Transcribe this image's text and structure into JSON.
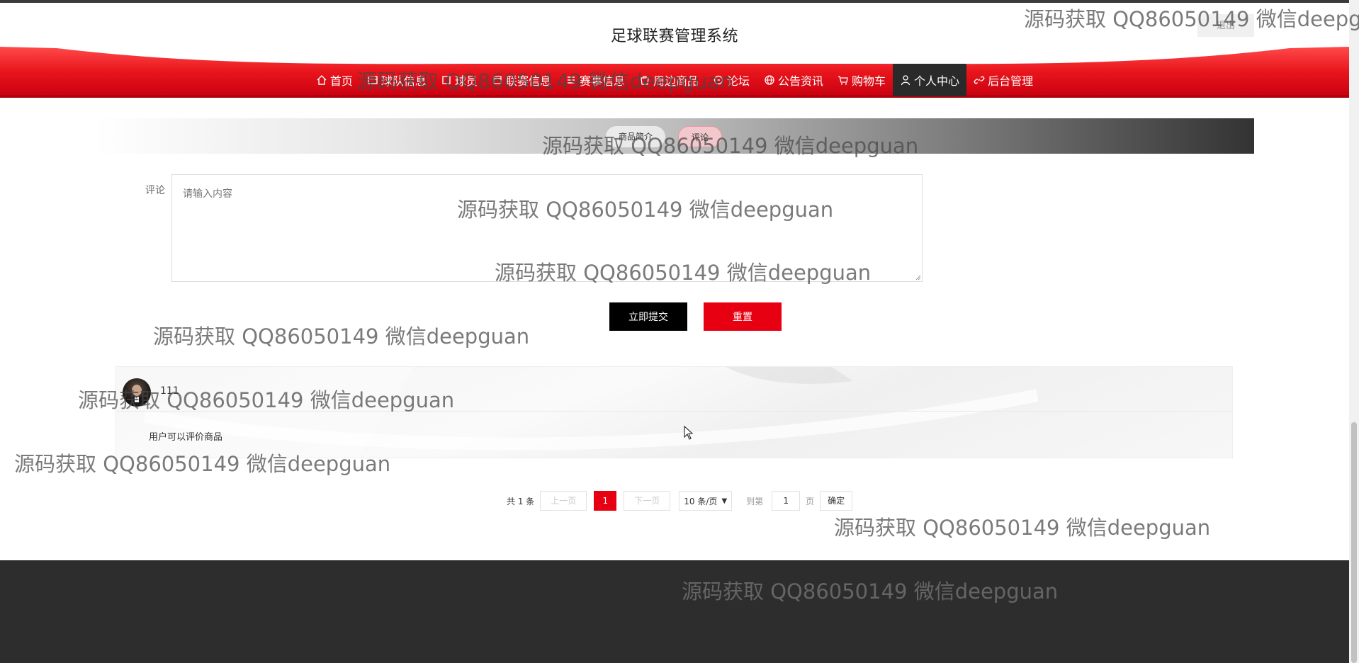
{
  "header": {
    "site_title": "足球联赛管理系统",
    "logout_label": "退出"
  },
  "nav": {
    "items": [
      {
        "label": "首页",
        "icon": "home-icon"
      },
      {
        "label": "球队信息",
        "icon": "team-icon"
      },
      {
        "label": "球员",
        "icon": "player-icon"
      },
      {
        "label": "联赛信息",
        "icon": "league-icon"
      },
      {
        "label": "赛事信息",
        "icon": "match-icon"
      },
      {
        "label": "周边商品",
        "icon": "goods-icon"
      },
      {
        "label": "论坛",
        "icon": "forum-icon"
      },
      {
        "label": "公告资讯",
        "icon": "globe-icon"
      },
      {
        "label": "购物车",
        "icon": "cart-icon"
      },
      {
        "label": "个人中心",
        "icon": "user-icon",
        "active": true
      },
      {
        "label": "后台管理",
        "icon": "link-icon"
      }
    ]
  },
  "banner": {
    "tabs": [
      {
        "label": "商品简介"
      },
      {
        "label": "评论",
        "active": true
      }
    ]
  },
  "comment_form": {
    "label": "评论",
    "placeholder": "请输入内容",
    "value": "",
    "submit_label": "立即提交",
    "reset_label": "重置"
  },
  "comments": [
    {
      "username": "111",
      "text": "用户可以评价商品"
    }
  ],
  "pagination": {
    "total_text": "共 1 条",
    "prev_label": "上一页",
    "current_page": "1",
    "next_label": "下一页",
    "page_size_label": "10 条/页",
    "goto_label": "到第",
    "goto_value": "1",
    "page_suffix": "页",
    "confirm_label": "确定"
  },
  "watermark": "源码获取 QQ86050149 微信deepguan",
  "colors": {
    "accent_red": "#e60012",
    "active_nav_bg": "#2a2a2a",
    "footer_bg": "#2d2d2d"
  }
}
